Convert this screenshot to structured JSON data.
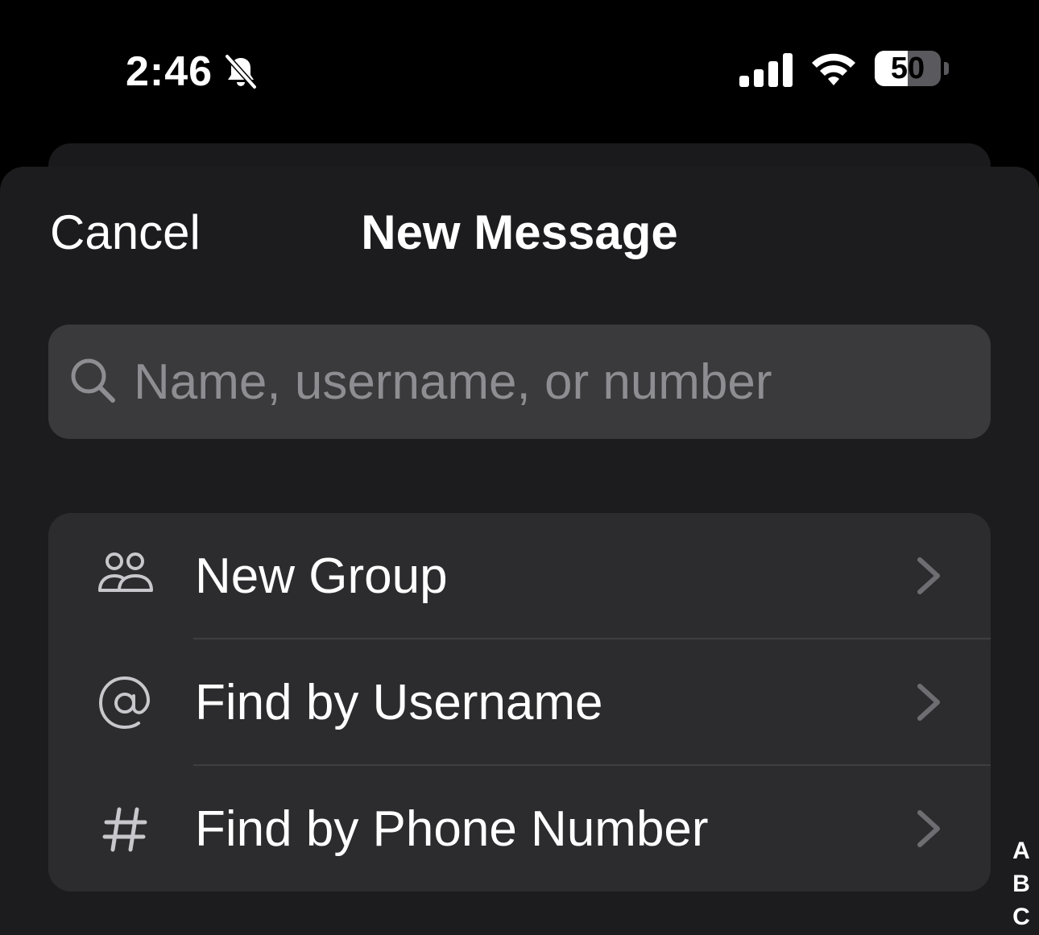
{
  "status_bar": {
    "time": "2:46",
    "battery_level": "50",
    "battery_fraction": 0.5,
    "icons": [
      "bell-slash-icon",
      "cellular-signal-icon",
      "wifi-icon",
      "battery-icon"
    ]
  },
  "header": {
    "cancel_label": "Cancel",
    "title": "New Message"
  },
  "search": {
    "placeholder": "Name, username, or number",
    "value": ""
  },
  "menu": {
    "items": [
      {
        "label": "New Group",
        "icon": "group-icon"
      },
      {
        "label": "Find by Username",
        "icon": "at-sign-icon"
      },
      {
        "label": "Find by Phone Number",
        "icon": "hashtag-icon"
      }
    ]
  },
  "index": {
    "letters": [
      "A",
      "B",
      "C"
    ]
  },
  "colors": {
    "background": "#000000",
    "sheet": "#1c1c1e",
    "search_field": "#3a3a3c",
    "card": "#2c2c2e",
    "placeholder": "#8d8d92",
    "chevron": "#6d6d72"
  }
}
